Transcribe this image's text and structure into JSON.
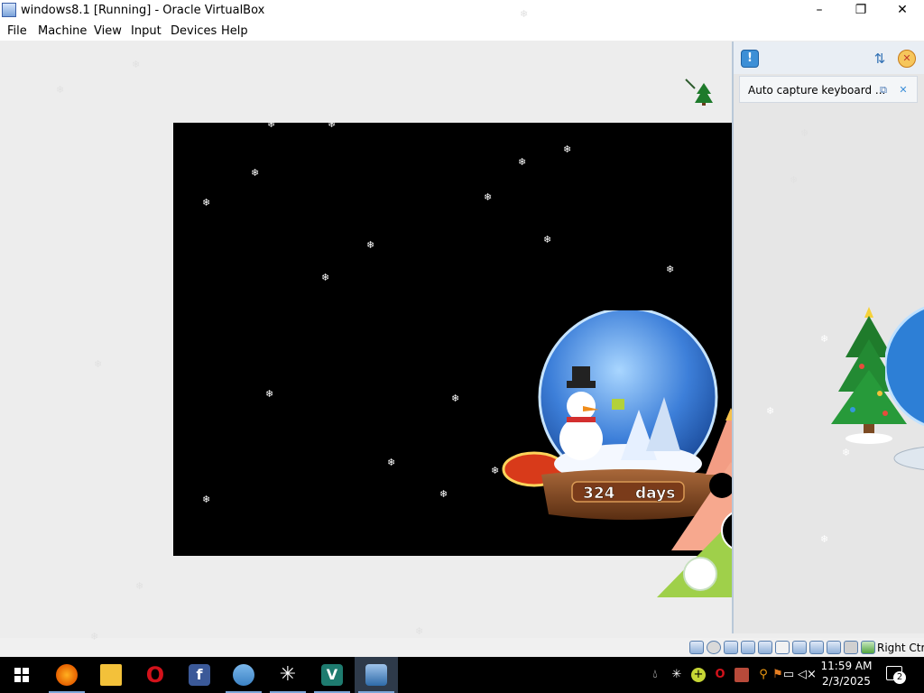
{
  "window": {
    "title": "windows8.1 [Running] - Oracle VirtualBox",
    "controls": {
      "minimize": "–",
      "maximize": "❐",
      "close": "✕"
    }
  },
  "menu": {
    "items": [
      {
        "label": "File"
      },
      {
        "label": "Machine"
      },
      {
        "label": "View"
      },
      {
        "label": "Input"
      },
      {
        "label": "Devices"
      },
      {
        "label": "Help"
      }
    ]
  },
  "notification_panel": {
    "header_icons": [
      "info-icon",
      "sort-icon",
      "close-all-icon"
    ],
    "messages": [
      {
        "text": "Auto capture keyboard ...",
        "icons": [
          "help-icon",
          "close-icon"
        ]
      }
    ]
  },
  "guest": {
    "countdown": {
      "value": "324",
      "unit": "days"
    }
  },
  "statusbar": {
    "device_icons": [
      "hard-disk-icon",
      "optical-drive-icon",
      "audio-icon",
      "network-icon",
      "usb-icon",
      "shared-folders-icon",
      "display-icon",
      "video-capture-icon",
      "recording-icon",
      "cpu-icon",
      "mouse-integration-icon",
      "keyboard-icon"
    ],
    "host_key": "Right Ctrl"
  },
  "taskbar": {
    "apps": [
      {
        "name": "Firefox",
        "icon": "firefox-icon",
        "color": "#e66000"
      },
      {
        "name": "File Explorer",
        "icon": "folder-icon",
        "color": "#f3c13a"
      },
      {
        "name": "Opera",
        "icon": "opera-icon",
        "color": "#d3121b"
      },
      {
        "name": "Facebook",
        "icon": "facebook-icon",
        "color": "#3b5998"
      },
      {
        "name": "People",
        "icon": "people-icon",
        "color": "#3b82c4"
      },
      {
        "name": "Snowflake",
        "icon": "snowflake-icon",
        "color": "#000000"
      },
      {
        "name": "VeraCrypt",
        "icon": "veracrypt-icon",
        "color": "#1e7b6f"
      },
      {
        "name": "VirtualBox",
        "icon": "virtualbox-icon",
        "color": "#2e6aa8"
      }
    ],
    "tray_icons": [
      "droplet-icon",
      "snowflake-tray-icon",
      "plus-circle-icon",
      "opera-tray-icon",
      "printer-icon",
      "magnifier-icon",
      "security-icon",
      "network-tray-icon",
      "volume-muted-icon"
    ],
    "clock": {
      "time": "11:59 AM",
      "date": "2/3/2025"
    },
    "notifications_count": "2"
  },
  "colors": {
    "guest_background": "#000000",
    "vm_background": "#ededed",
    "taskbar": "#000000"
  }
}
